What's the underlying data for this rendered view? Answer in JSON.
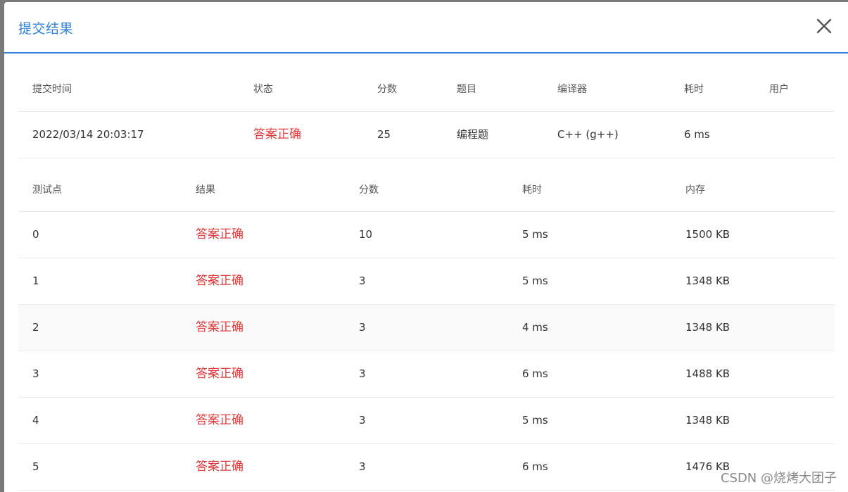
{
  "dialog": {
    "title": "提交结果",
    "close_icon": "close-icon"
  },
  "submission": {
    "headers": {
      "time": "提交时间",
      "status": "状态",
      "score": "分数",
      "problem": "题目",
      "compiler": "编译器",
      "time_cost": "耗时",
      "user": "用户"
    },
    "row": {
      "time": "2022/03/14 20:03:17",
      "status": "答案正确",
      "score": "25",
      "problem": "编程题",
      "compiler": "C++ (g++)",
      "time_cost": "6 ms",
      "user": ""
    }
  },
  "cases": {
    "headers": {
      "case": "测试点",
      "result": "结果",
      "score": "分数",
      "time_cost": "耗时",
      "memory": "内存"
    },
    "rows": [
      {
        "case": "0",
        "result": "答案正确",
        "score": "10",
        "time_cost": "5 ms",
        "memory": "1500 KB"
      },
      {
        "case": "1",
        "result": "答案正确",
        "score": "3",
        "time_cost": "5 ms",
        "memory": "1348 KB"
      },
      {
        "case": "2",
        "result": "答案正确",
        "score": "3",
        "time_cost": "4 ms",
        "memory": "1348 KB"
      },
      {
        "case": "3",
        "result": "答案正确",
        "score": "3",
        "time_cost": "6 ms",
        "memory": "1488 KB"
      },
      {
        "case": "4",
        "result": "答案正确",
        "score": "3",
        "time_cost": "5 ms",
        "memory": "1348 KB"
      },
      {
        "case": "5",
        "result": "答案正确",
        "score": "3",
        "time_cost": "6 ms",
        "memory": "1476 KB"
      }
    ]
  },
  "watermark": "CSDN @烧烤大团子",
  "colors": {
    "accent": "#2f7fd9",
    "accepted": "#e23b3b"
  }
}
